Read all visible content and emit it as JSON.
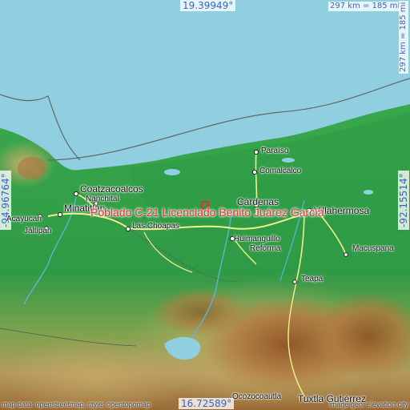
{
  "map": {
    "place_name": "Poblado C-21 Licenciado Benito Juárez García",
    "coords": {
      "top": "19.39949°",
      "bottom": "16.72589°",
      "left": "-94.96764°",
      "right": "-92.15514°"
    },
    "scale": {
      "horizontal": "297 km = 185 mi",
      "vertical": "297 km = 185 mi"
    },
    "cities": {
      "paraiso": "Paraíso",
      "comalcalco": "Comalcalco",
      "coatzacoalcos": "Coatzacoalcos",
      "nanchital": "Nanchital",
      "minatitlan": "Minatitlán",
      "acayucan": "Acayucan",
      "jaltipan": "Jáltipan",
      "las_choapas": "Las Choapas",
      "cardenas": "Cárdenas",
      "villahermosa": "Villahermosa",
      "huimanguillo": "Huimanguillo",
      "reforma": "Reforma",
      "macuspana": "Macuspana",
      "teapa": "Teapa",
      "ocozocoautla": "Ocozocoautla",
      "tuxtla": "Tuxtla Gutiérrez"
    },
    "attribution": {
      "left": "map data: openstreetmap, style: opentopomap",
      "right": "image geo: elevation.city"
    },
    "colors": {
      "sea": "#8fcfe0",
      "lowland": "#2d9d47",
      "hills": "#b7a565",
      "mountains": "#a5672f",
      "label_highlight": "#e43030",
      "coord_text": "#3a63c8"
    }
  }
}
